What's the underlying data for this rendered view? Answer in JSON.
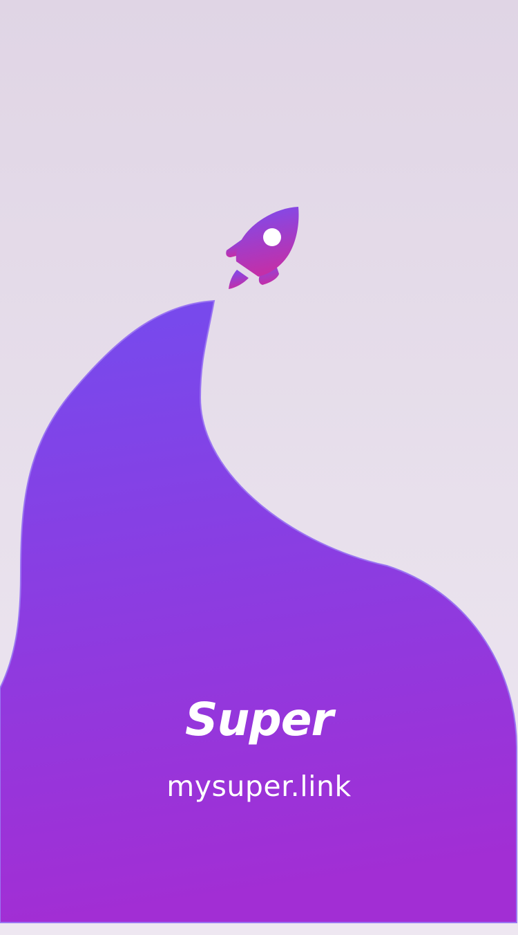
{
  "splash": {
    "brand_name": "Super",
    "url": "mysuper.link"
  },
  "icons": {
    "logo": "rocket-icon"
  },
  "colors": {
    "background_top": "#e0d5e5",
    "background_bottom": "#eee7f1",
    "wave_top": "#754bee",
    "wave_bottom": "#a22ed4",
    "rocket_top": "#7a4df0",
    "rocket_bottom": "#c32fa8",
    "text": "#ffffff"
  }
}
